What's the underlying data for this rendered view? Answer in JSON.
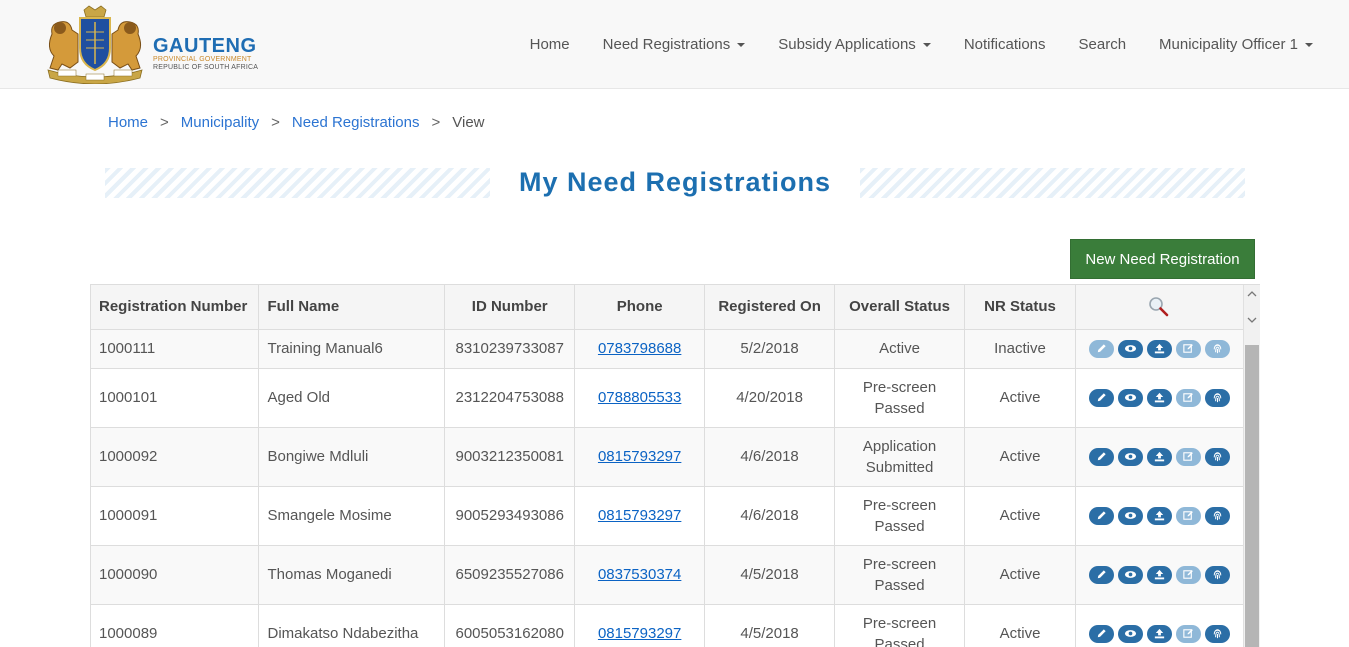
{
  "header": {
    "logo": {
      "title": "GAUTENG",
      "subtitle": "PROVINCIAL GOVERNMENT",
      "subtitle2": "REPUBLIC OF SOUTH AFRICA"
    },
    "nav": {
      "home": "Home",
      "need_registrations": "Need Registrations",
      "subsidy_applications": "Subsidy Applications",
      "notifications": "Notifications",
      "search": "Search",
      "user": "Municipality Officer 1"
    }
  },
  "breadcrumb": {
    "items": [
      "Home",
      "Municipality",
      "Need Registrations"
    ],
    "separator": ">",
    "active": "View"
  },
  "page": {
    "title": "My Need Registrations",
    "new_button": "New Need Registration"
  },
  "table": {
    "headers": [
      "Registration Number",
      "Full Name",
      "ID Number",
      "Phone",
      "Registered On",
      "Overall Status",
      "NR Status"
    ],
    "search_icon": "search-icon",
    "rows": [
      {
        "reg": "1000111",
        "name": "Training Manual6",
        "id": "8310239733087",
        "phone": "0783798688",
        "date": "5/2/2018",
        "status_l1": "Active",
        "status_l2": "",
        "nr": "Inactive"
      },
      {
        "reg": "1000101",
        "name": "Aged Old",
        "id": "2312204753088",
        "phone": "0788805533",
        "date": "4/20/2018",
        "status_l1": "Pre-screen",
        "status_l2": "Passed",
        "nr": "Active"
      },
      {
        "reg": "1000092",
        "name": "Bongiwe Mdluli",
        "id": "9003212350081",
        "phone": "0815793297",
        "date": "4/6/2018",
        "status_l1": "Application",
        "status_l2": "Submitted",
        "nr": "Active"
      },
      {
        "reg": "1000091",
        "name": "Smangele Mosime",
        "id": "9005293493086",
        "phone": "0815793297",
        "date": "4/6/2018",
        "status_l1": "Pre-screen",
        "status_l2": "Passed",
        "nr": "Active"
      },
      {
        "reg": "1000090",
        "name": "Thomas Moganedi",
        "id": "6509235527086",
        "phone": "0837530374",
        "date": "4/5/2018",
        "status_l1": "Pre-screen",
        "status_l2": "Passed",
        "nr": "Active"
      },
      {
        "reg": "1000089",
        "name": "Dimakatso Ndabezitha",
        "id": "6005053162080",
        "phone": "0815793297",
        "date": "4/5/2018",
        "status_l1": "Pre-screen",
        "status_l2": "Passed",
        "nr": "Active"
      }
    ],
    "action_icons": [
      "edit-icon",
      "view-icon",
      "upload-icon",
      "edit-note-icon",
      "fingerprint-icon"
    ]
  },
  "colors": {
    "brand_blue": "#1c6fb0",
    "link_blue": "#2c74d2",
    "button_green": "#3a7d3a",
    "action_blue": "#2b6ea6",
    "action_faded": "#8fb8d8"
  }
}
